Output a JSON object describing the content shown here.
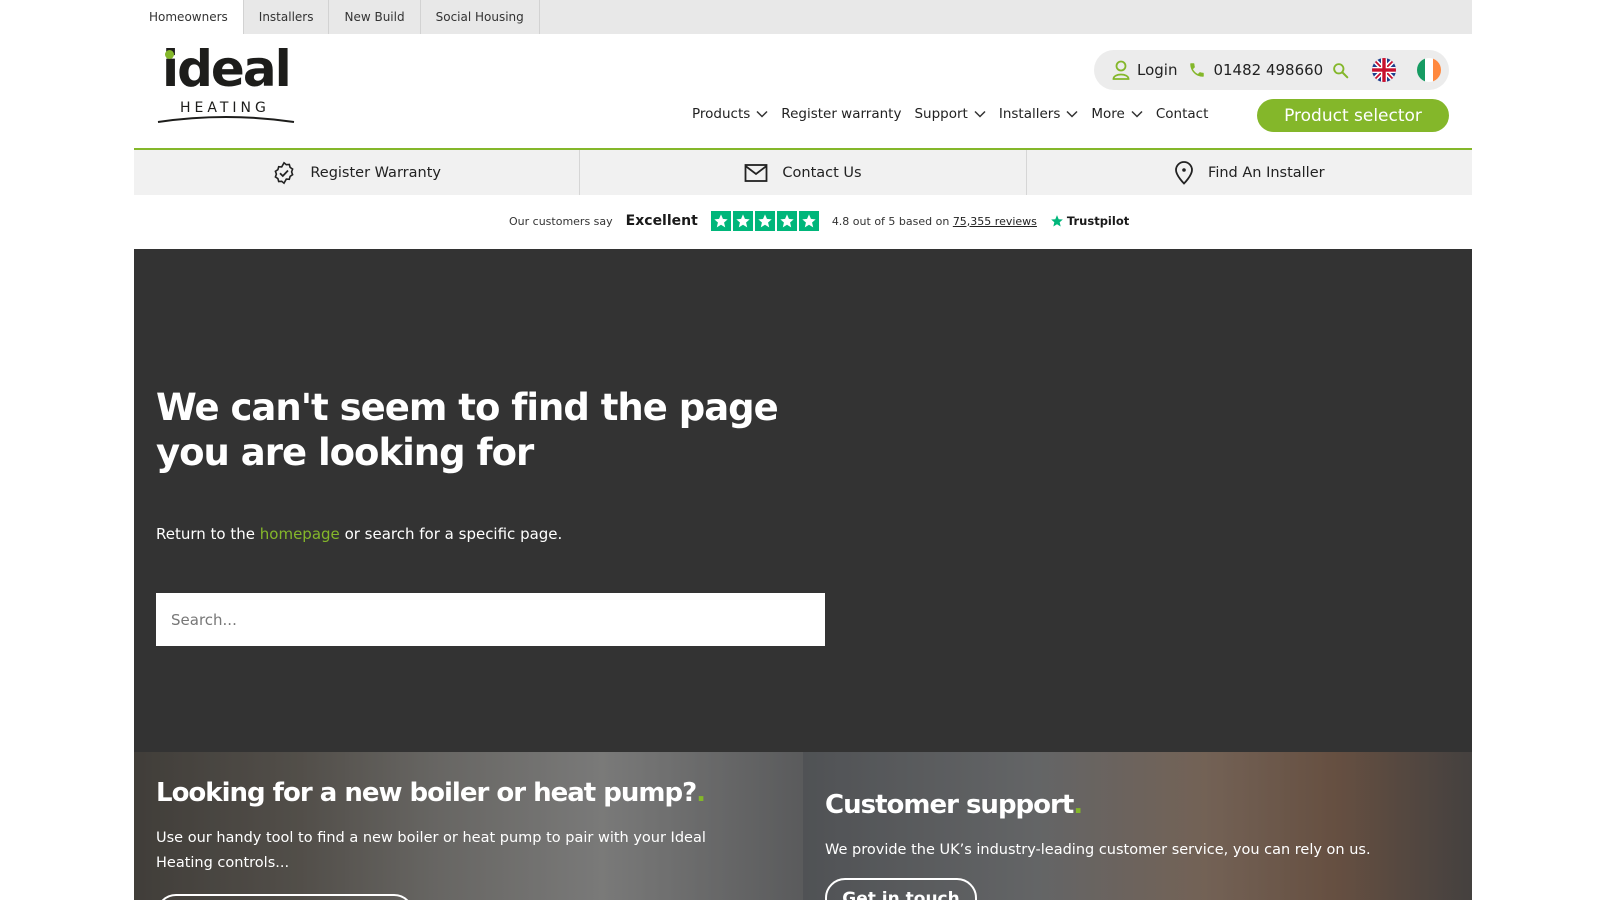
{
  "audience_tabs": [
    {
      "label": "Homeowners",
      "active": true
    },
    {
      "label": "Installers",
      "active": false
    },
    {
      "label": "New Build",
      "active": false
    },
    {
      "label": "Social Housing",
      "active": false
    }
  ],
  "logo": {
    "word": "ideal",
    "sub": "HEATING"
  },
  "utility": {
    "login_label": "Login",
    "phone": "01482 498660",
    "icons": [
      "user-icon",
      "phone-icon",
      "search-icon",
      "uk-flag-icon",
      "ireland-flag-icon"
    ]
  },
  "nav": {
    "items": [
      {
        "label": "Products",
        "dropdown": true
      },
      {
        "label": "Register warranty",
        "dropdown": false
      },
      {
        "label": "Support",
        "dropdown": true
      },
      {
        "label": "Installers",
        "dropdown": true
      },
      {
        "label": "More",
        "dropdown": true
      },
      {
        "label": "Contact",
        "dropdown": false
      }
    ],
    "cta_label": "Product selector"
  },
  "quick_links": [
    {
      "label": "Register Warranty",
      "icon": "badge-check-icon"
    },
    {
      "label": "Contact Us",
      "icon": "envelope-icon"
    },
    {
      "label": "Find An Installer",
      "icon": "map-pin-icon"
    }
  ],
  "trustpilot": {
    "intro": "Our customers say",
    "rating_word": "Excellent",
    "score_prefix": "4.8 out of 5 based on",
    "reviews_link": "75,355 reviews",
    "brand": "Trustpilot",
    "stars": 5
  },
  "hero": {
    "title": "We can't seem to find the page you are looking for",
    "return_prefix": "Return to the",
    "homepage_link": "homepage",
    "return_suffix": "or search for a specific page.",
    "search_placeholder": "Search..."
  },
  "cards": {
    "left": {
      "title": "Looking for a new boiler or heat pump?",
      "body": "Use our handy tool to find a new boiler or heat pump to pair with your Ideal Heating controls..."
    },
    "right": {
      "title": "Customer support",
      "body": "We provide the UK’s industry-leading customer service, you can rely on us.",
      "cta": "Get in touch"
    }
  },
  "colors": {
    "brand_green": "#84b72a",
    "hero_bg": "#333333",
    "trustpilot_green": "#00b67a"
  }
}
